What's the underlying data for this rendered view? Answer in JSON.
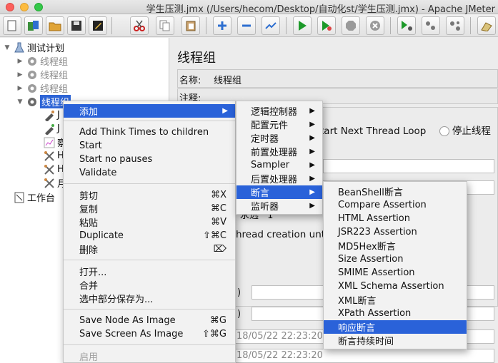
{
  "window": {
    "title": "学生压测.jmx (/Users/hecom/Desktop/自动化st/学生压测.jmx) - Apache JMeter"
  },
  "toolbar": {
    "buttons": [
      "new-icon",
      "templates-icon",
      "open-icon",
      "save-icon",
      "edit-icon",
      "cut-icon",
      "copy-icon",
      "paste-icon",
      "expand-icon",
      "collapse-icon",
      "toggle-icon",
      "start-icon",
      "start-no-pause-icon",
      "stop-icon",
      "shutdown-icon",
      "remote-start-icon",
      "remote-stop-icon",
      "remote-shutdown-icon",
      "clear-icon"
    ]
  },
  "tree": {
    "test_plan": "测试计划",
    "thread_groups": [
      "线程组",
      "线程组",
      "线程组"
    ],
    "selected": "线程组",
    "children": [
      "J",
      "J",
      "察",
      "H",
      "H",
      "月"
    ],
    "workbench": "工作台"
  },
  "panel": {
    "title": "线程组",
    "name_label": "名称:",
    "name_value": "线程组",
    "comment_label": "注释:",
    "next_loop": "tart Next Thread Loop",
    "stop_thread": "停止线程",
    "loop_fragment": "永远",
    "loop_value": "1",
    "delay_text": "hread creation until",
    "paren1": ")",
    "paren2": ")",
    "date1": "18/05/22 22:23:20",
    "date2": "18/05/22 22:23:20"
  },
  "context_menu": {
    "add": "添加",
    "think_times": "Add Think Times to children",
    "start": "Start",
    "start_no_pauses": "Start no pauses",
    "validate": "Validate",
    "cut": "剪切",
    "cut_sc": "⌘X",
    "copy": "复制",
    "copy_sc": "⌘C",
    "paste": "粘贴",
    "paste_sc": "⌘V",
    "duplicate": "Duplicate",
    "duplicate_sc": "⇧⌘C",
    "delete": "删除",
    "delete_sc": "⌦",
    "open": "打开...",
    "merge": "合并",
    "save_selection": "选中部分保存为...",
    "save_node_image": "Save Node As Image",
    "save_node_image_sc": "⌘G",
    "save_screen_image": "Save Screen As Image",
    "save_screen_image_sc": "⇧⌘G",
    "enable": "启用"
  },
  "add_submenu": {
    "items": [
      "逻辑控制器",
      "配置元件",
      "定时器",
      "前置处理器",
      "Sampler",
      "后置处理器",
      "断言",
      "监听器"
    ],
    "highlighted": "断言"
  },
  "assertion_submenu": {
    "items": [
      "BeanShell断言",
      "Compare Assertion",
      "HTML Assertion",
      "JSR223 Assertion",
      "MD5Hex断言",
      "Size Assertion",
      "SMIME Assertion",
      "XML Schema Assertion",
      "XML断言",
      "XPath Assertion",
      "响应断言",
      "断言持续时间"
    ],
    "highlighted": "响应断言"
  },
  "colors": {
    "selection": "#2a62d9",
    "menu_bg": "#f2f2f2"
  }
}
